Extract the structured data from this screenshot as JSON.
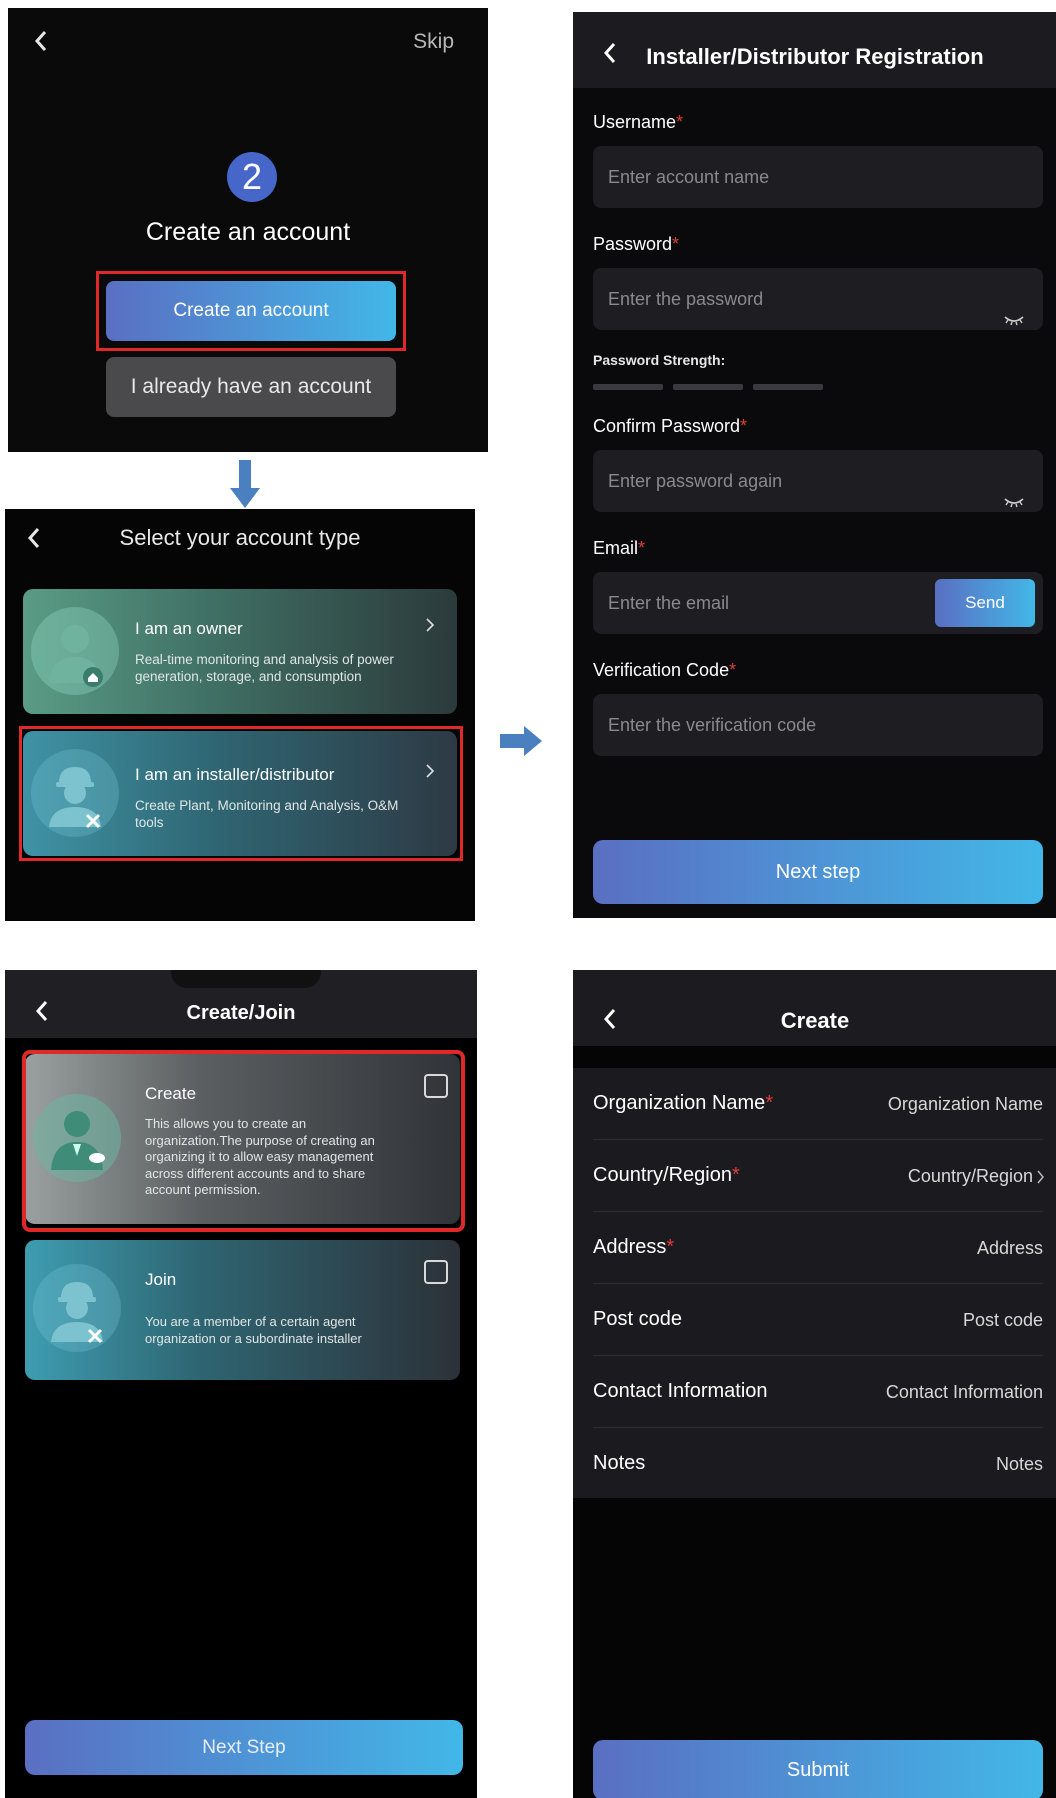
{
  "panel1": {
    "skip": "Skip",
    "step": "2",
    "title": "Create an account",
    "create_btn": "Create an account",
    "existing_btn": "I already have an account"
  },
  "panel2": {
    "title": "Select your account type",
    "owner": {
      "title": "I am an owner",
      "desc1": "Real-time monitoring and analysis of power",
      "desc2": "generation, storage, and consumption"
    },
    "installer": {
      "title": "I am an installer/distributor",
      "desc1": "Create Plant, Monitoring and Analysis, O&M",
      "desc2": "tools"
    }
  },
  "panel3": {
    "title": "Installer/Distributor Registration",
    "username_label": "Username",
    "username_placeholder": "Enter account name",
    "password_label": "Password",
    "password_placeholder": "Enter the password",
    "strength_label": "Password Strength:",
    "confirm_label": "Confirm Password",
    "confirm_placeholder": "Enter password again",
    "email_label": "Email",
    "email_placeholder": "Enter the email",
    "send": "Send",
    "code_label": "Verification Code",
    "code_placeholder": "Enter the verification code",
    "next": "Next step",
    "required_mark": "*"
  },
  "panel4": {
    "title": "Create/Join",
    "create": {
      "title": "Create",
      "lines": [
        "This allows you to create an",
        "organization.The purpose of creating an",
        "organizing it to allow easy management",
        "across different accounts and to share",
        "account permission."
      ]
    },
    "join": {
      "title": "Join",
      "lines": [
        "You are a member of a certain agent",
        "organization or a subordinate installer"
      ]
    },
    "next": "Next Step"
  },
  "panel5": {
    "title": "Create",
    "rows": [
      {
        "label": "Organization Name",
        "required": "*",
        "value": "Organization Name"
      },
      {
        "label": "Country/Region",
        "required": "*",
        "value": "Country/Region"
      },
      {
        "label": "Address",
        "required": "*",
        "value": "Address"
      },
      {
        "label": "Post code",
        "required": "",
        "value": "Post code"
      },
      {
        "label": "Contact Information",
        "required": "",
        "value": "Contact Information"
      },
      {
        "label": "Notes",
        "required": "",
        "value": "Notes"
      }
    ],
    "submit": "Submit"
  },
  "icons": [
    "back-chevron-icon",
    "arrow-down-icon",
    "arrow-right-icon",
    "owner-avatar-icon",
    "installer-avatar-icon",
    "eye-hidden-icon",
    "checkbox-icon",
    "chevron-right-icon"
  ],
  "colors": {
    "accent_start": "#5a6fc2",
    "accent_end": "#42b7e8",
    "highlight": "#e02828",
    "required": "#e03b3b"
  }
}
